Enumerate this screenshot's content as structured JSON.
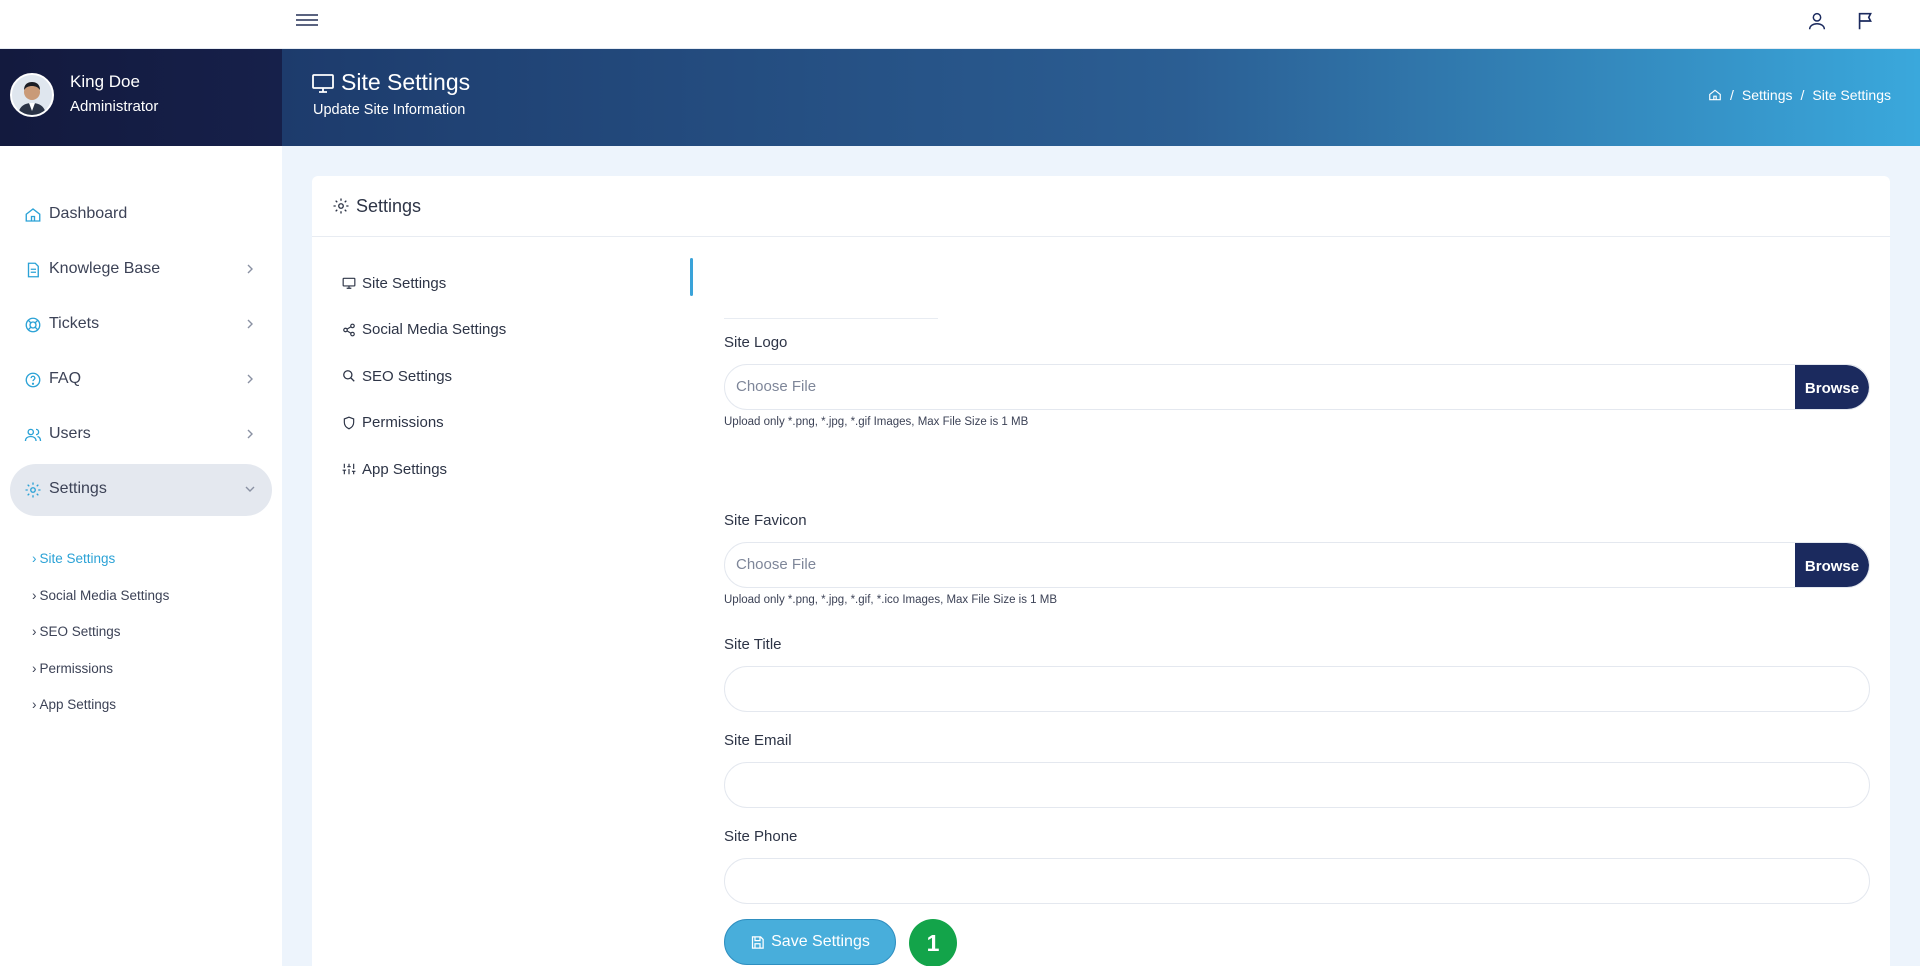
{
  "user": {
    "name": "King Doe",
    "role": "Administrator"
  },
  "sidebar": {
    "items": [
      {
        "label": "Dashboard",
        "icon": "home-icon"
      },
      {
        "label": "Knowlege Base",
        "icon": "document-icon"
      },
      {
        "label": "Tickets",
        "icon": "lifebuoy-icon"
      },
      {
        "label": "FAQ",
        "icon": "help-circle-icon"
      },
      {
        "label": "Users",
        "icon": "users-icon"
      },
      {
        "label": "Settings",
        "icon": "gear-icon"
      }
    ],
    "sub_items": [
      "Site Settings",
      "Social Media Settings",
      "SEO Settings",
      "Permissions",
      "App Settings"
    ]
  },
  "header": {
    "title": "Site Settings",
    "subtitle": "Update Site Information",
    "breadcrumb": [
      "Settings",
      "Site Settings"
    ]
  },
  "card": {
    "title": "Settings",
    "tabs": [
      {
        "label": "Site Settings",
        "icon": "monitor-icon"
      },
      {
        "label": "Social Media Settings",
        "icon": "share-icon"
      },
      {
        "label": "SEO Settings",
        "icon": "search-icon"
      },
      {
        "label": "Permissions",
        "icon": "shield-icon"
      },
      {
        "label": "App Settings",
        "icon": "sliders-icon"
      }
    ]
  },
  "form": {
    "logo_label": "Site Logo",
    "logo_placeholder": "Choose File",
    "logo_help": "Upload only *.png, *.jpg, *.gif Images, Max File Size is 1 MB",
    "favicon_label": "Site Favicon",
    "favicon_placeholder": "Choose File",
    "favicon_help": "Upload only *.png, *.jpg, *.gif, *.ico Images, Max File Size is 1 MB",
    "browse_label": "Browse",
    "title_label": "Site Title",
    "title_value": "",
    "email_label": "Site Email",
    "email_value": "",
    "phone_label": "Site Phone",
    "phone_value": "",
    "save_label": "Save Settings",
    "step_badge": "1"
  },
  "colors": {
    "accent": "#48aedb",
    "navy": "#1b2a5e",
    "badge": "#13a44a"
  }
}
